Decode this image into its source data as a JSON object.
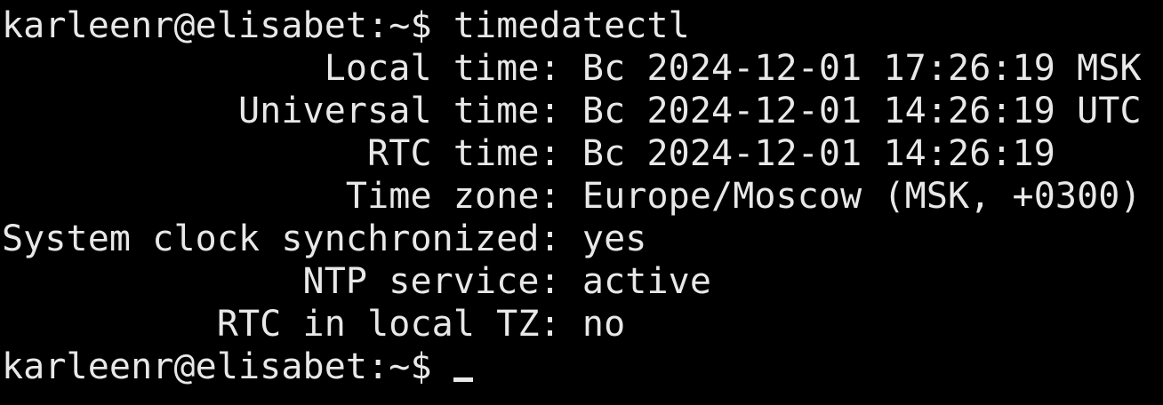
{
  "terminal": {
    "prompt": "karleenr@elisabet:~$ ",
    "command": "timedatectl",
    "output": [
      "               Local time: Вс 2024-12-01 17:26:19 MSK",
      "           Universal time: Вс 2024-12-01 14:26:19 UTC",
      "                 RTC time: Вс 2024-12-01 14:26:19",
      "                Time zone: Europe/Moscow (MSK, +0300)",
      "System clock synchronized: yes",
      "              NTP service: active",
      "          RTC in local TZ: no"
    ],
    "colors": {
      "background": "#000000",
      "foreground": "#e8e8e8"
    }
  }
}
